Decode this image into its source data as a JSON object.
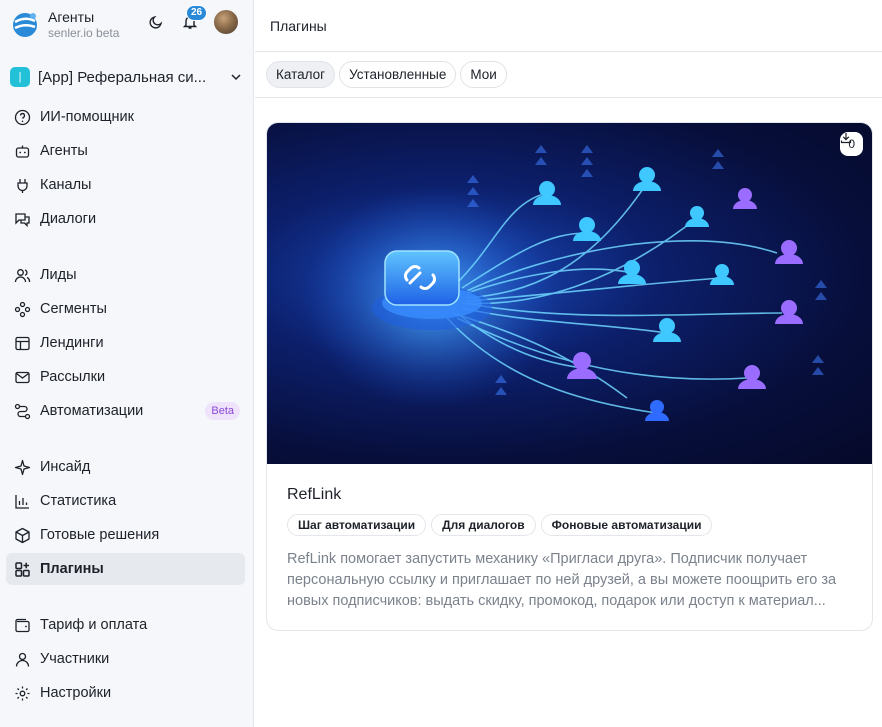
{
  "brand": {
    "title": "Агенты",
    "subtitle": "senler.io beta",
    "notifications": "26"
  },
  "project": {
    "icon_text": "|",
    "name": "[App] Реферальная си..."
  },
  "nav": {
    "group1": [
      {
        "label": "ИИ-помощник",
        "icon": "help-circle-icon"
      },
      {
        "label": "Агенты",
        "icon": "robot-icon"
      },
      {
        "label": "Каналы",
        "icon": "plug-icon"
      },
      {
        "label": "Диалоги",
        "icon": "chat-icon"
      }
    ],
    "group2": [
      {
        "label": "Лиды",
        "icon": "users-icon"
      },
      {
        "label": "Сегменты",
        "icon": "segments-icon"
      },
      {
        "label": "Лендинги",
        "icon": "layout-icon"
      },
      {
        "label": "Рассылки",
        "icon": "mail-icon"
      },
      {
        "label": "Автоматизации",
        "icon": "route-icon",
        "badge": "Beta"
      }
    ],
    "group3": [
      {
        "label": "Инсайд",
        "icon": "sparkle-icon"
      },
      {
        "label": "Статистика",
        "icon": "bar-chart-icon"
      },
      {
        "label": "Готовые решения",
        "icon": "package-icon"
      },
      {
        "label": "Плагины",
        "icon": "puzzle-icon",
        "active": true
      }
    ],
    "group4": [
      {
        "label": "Тариф и оплата",
        "icon": "wallet-icon"
      },
      {
        "label": "Участники",
        "icon": "user-icon"
      },
      {
        "label": "Настройки",
        "icon": "gear-icon"
      }
    ]
  },
  "header": {
    "title": "Плагины"
  },
  "tabs": [
    {
      "label": "Каталог",
      "active": true
    },
    {
      "label": "Установленные"
    },
    {
      "label": "Мои"
    }
  ],
  "plugin": {
    "downloads": "0",
    "title": "RefLink",
    "tags": [
      "Шаг автоматизации",
      "Для диалогов",
      "Фоновые автоматизации"
    ],
    "description": "RefLink помогает запустить механику «Пригласи друга». Подписчик получает персональную ссылку и приглашает по ней друзей, а вы можете поощрить его за новых подписчиков: выдать скидку, промокод, подарок или доступ к материал..."
  },
  "colors": {
    "accent": "#2b8ad8",
    "beta_bg": "#efe3fb",
    "beta_fg": "#8a4ad6",
    "project": "#22c1d8",
    "active_bg": "#e6e9ee"
  }
}
